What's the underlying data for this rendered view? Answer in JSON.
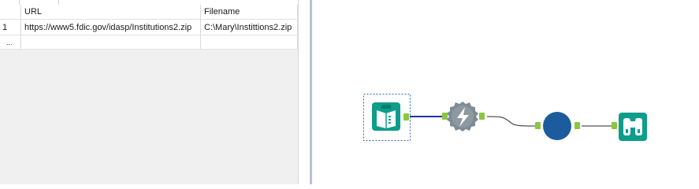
{
  "grid": {
    "columns": [
      "URL",
      "Filename"
    ],
    "rows": [
      {
        "num": "1",
        "url": "https://www5.fdic.gov/idasp/Institutions2.zip",
        "filename": "C:\\Mary\\Instittions2.zip"
      }
    ],
    "new_row_marker": "..."
  },
  "workflow": {
    "tools": [
      {
        "name": "text-input-tool",
        "color": "#0e9d8b"
      },
      {
        "name": "download-tool",
        "color": "#7d8b94"
      },
      {
        "name": "formula-tool",
        "color": "#1c5c9c"
      },
      {
        "name": "browse-tool",
        "color": "#0e9d8b"
      }
    ],
    "connection_colors": {
      "selected": "#2233aa",
      "normal": "#555555"
    },
    "anchor_color": "#8cc63f"
  }
}
